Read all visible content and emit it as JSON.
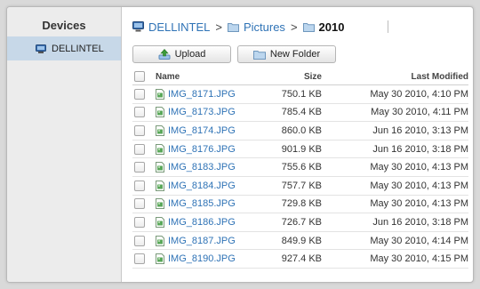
{
  "sidebar": {
    "title": "Devices",
    "items": [
      {
        "label": "DELLINTEL"
      }
    ]
  },
  "breadcrumb": {
    "items": [
      "DELLINTEL",
      "Pictures"
    ],
    "separator": ">",
    "current": "2010"
  },
  "toolbar": {
    "upload_label": "Upload",
    "new_folder_label": "New Folder"
  },
  "table": {
    "headers": {
      "name": "Name",
      "size": "Size",
      "modified": "Last Modified"
    },
    "rows": [
      {
        "name": "IMG_8171.JPG",
        "size": "750.1 KB",
        "modified": "May 30 2010, 4:10 PM"
      },
      {
        "name": "IMG_8173.JPG",
        "size": "785.4 KB",
        "modified": "May 30 2010, 4:11 PM"
      },
      {
        "name": "IMG_8174.JPG",
        "size": "860.0 KB",
        "modified": "Jun 16 2010, 3:13 PM"
      },
      {
        "name": "IMG_8176.JPG",
        "size": "901.9 KB",
        "modified": "Jun 16 2010, 3:18 PM"
      },
      {
        "name": "IMG_8183.JPG",
        "size": "755.6 KB",
        "modified": "May 30 2010, 4:13 PM"
      },
      {
        "name": "IMG_8184.JPG",
        "size": "757.7 KB",
        "modified": "May 30 2010, 4:13 PM"
      },
      {
        "name": "IMG_8185.JPG",
        "size": "729.8 KB",
        "modified": "May 30 2010, 4:13 PM"
      },
      {
        "name": "IMG_8186.JPG",
        "size": "726.7 KB",
        "modified": "Jun 16 2010, 3:18 PM"
      },
      {
        "name": "IMG_8187.JPG",
        "size": "849.9 KB",
        "modified": "May 30 2010, 4:14 PM"
      },
      {
        "name": "IMG_8190.JPG",
        "size": "927.4 KB",
        "modified": "May 30 2010, 4:15 PM"
      }
    ]
  },
  "colors": {
    "link": "#2f73b6",
    "sidebar_selected": "#c7d8e8",
    "sidebar_bg": "#ececec"
  },
  "icons": {
    "device": "computer-icon",
    "folder": "folder-icon",
    "upload": "upload-arrow-icon",
    "file": "image-file-icon"
  }
}
